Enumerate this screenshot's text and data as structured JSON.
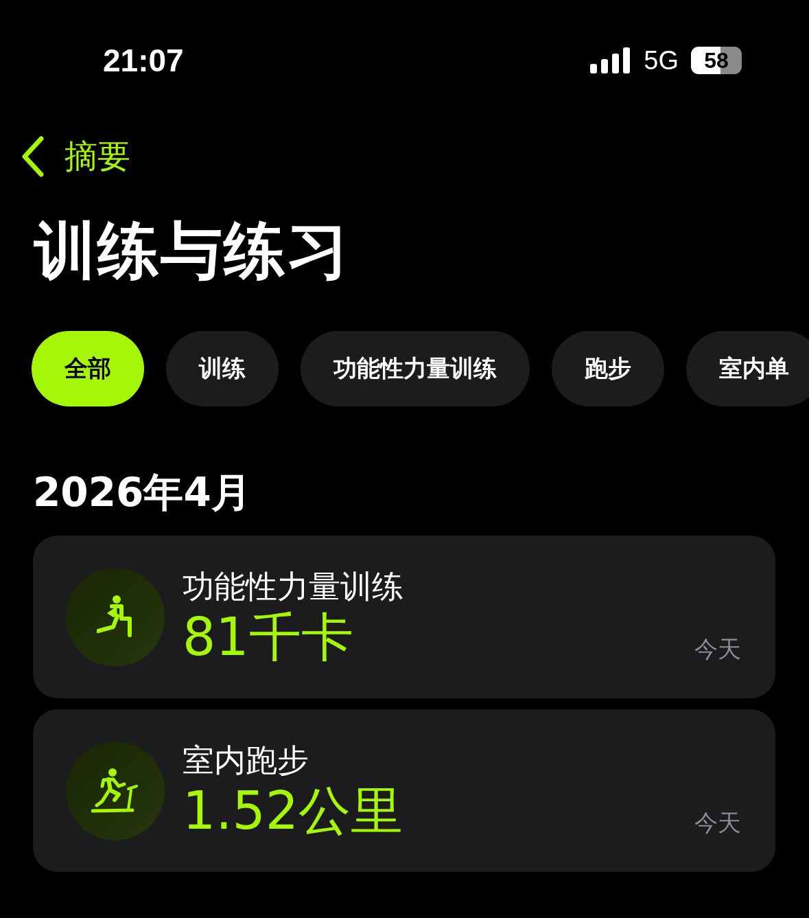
{
  "status_bar": {
    "time": "21:07",
    "network": "5G",
    "battery": "58"
  },
  "nav": {
    "back_label": "摘要"
  },
  "title": "训练与练习",
  "filters": [
    {
      "label": "全部",
      "selected": true
    },
    {
      "label": "训练",
      "selected": false
    },
    {
      "label": "功能性力量训练",
      "selected": false
    },
    {
      "label": "跑步",
      "selected": false
    },
    {
      "label": "室内单",
      "selected": false
    }
  ],
  "section": "2026年4月",
  "workouts": [
    {
      "kind": "strength",
      "name": "功能性力量训练",
      "value": "81千卡",
      "date": "今天"
    },
    {
      "kind": "treadmill",
      "name": "室内跑步",
      "value": "1.52公里",
      "date": "今天"
    }
  ]
}
